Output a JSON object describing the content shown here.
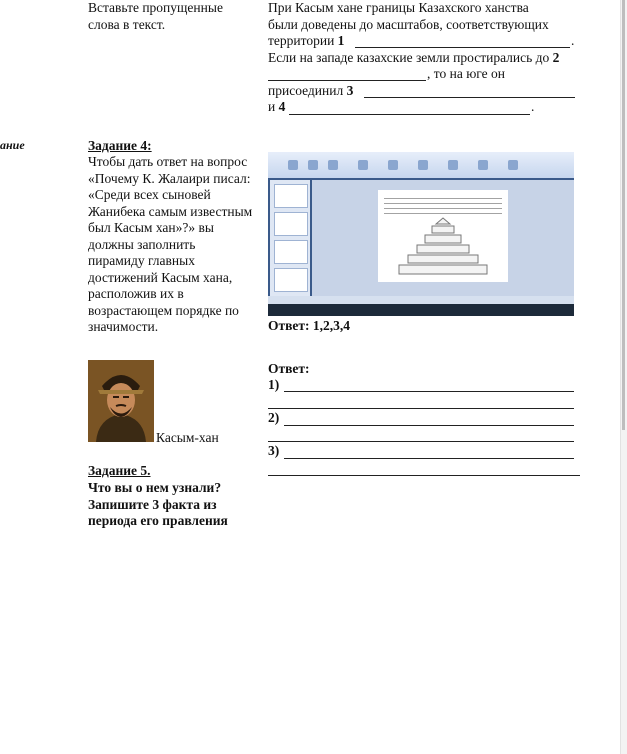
{
  "top_left": {
    "line1": "Вставьте пропущенные",
    "line2": "слова в текст."
  },
  "top_right": {
    "line1": "При Касым хане границы Казахского ханства",
    "line2": "были доведены до масштабов, соответствующих",
    "line3_text": "территории ",
    "line3_num": "1",
    "line4_text": "Если на западе казахские земли простирались до ",
    "line4_num": "2",
    "line5_text": ", то на юге он",
    "line6_text": "присоединил ",
    "line6_num": "3",
    "line7_text": "и ",
    "line7_num": "4",
    "period": "."
  },
  "left_edge": {
    "label": "ание"
  },
  "task4": {
    "title": "Задание 4:",
    "lines": [
      "Чтобы дать ответ на вопрос",
      "«Почему К. Жалаири писал:",
      "«Среди всех сыновей",
      "Жанибека самым известным",
      "был Касым хан»?» вы",
      "должны заполнить",
      "пирамиду главных",
      "достижений Касым хана,",
      "расположив их в",
      "возрастающем порядке по",
      "значимости."
    ],
    "answer": "Ответ: 1,2,3,4"
  },
  "task5": {
    "portrait_caption": "Касым-хан",
    "title": "Задание 5.",
    "lines": [
      "Что вы о нем узнали?",
      "Запишите 3 факта из",
      "периода его правления"
    ],
    "answer_label": "Ответ:",
    "answers": [
      "1)",
      "2)",
      "3)"
    ]
  },
  "colors": {
    "text": "#111111",
    "line": "#222222",
    "screenshot_bg": "#3a5a8a"
  },
  "icons": [
    "portrait-image",
    "presentation-screenshot",
    "pyramid-shape"
  ]
}
